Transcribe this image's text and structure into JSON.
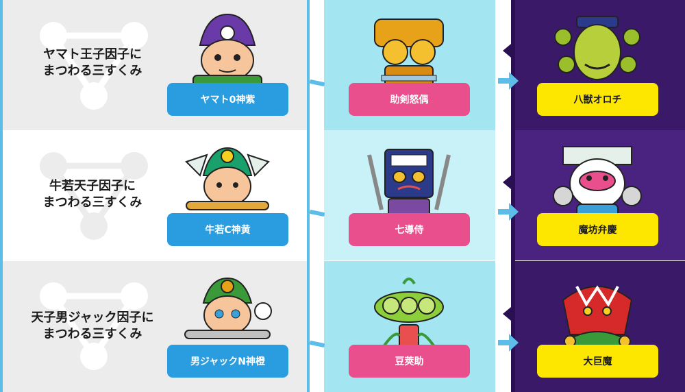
{
  "rows": [
    {
      "title": "ヤマト王子因子に\nまつわる三すくみ",
      "hero": "ヤマト0神紫",
      "mid": "助剣怒偶",
      "boss": "八獣オロチ",
      "hero_icon": "hero-prince-icon",
      "mid_icon": "golden-mask-icon",
      "boss_icon": "hydra-icon"
    },
    {
      "title": "牛若天子因子に\nまつわる三すくみ",
      "hero": "牛若C神黄",
      "mid": "七導侍",
      "boss": "魔坊弁慶",
      "hero_icon": "hero-angel-icon",
      "mid_icon": "slot-robot-icon",
      "boss_icon": "monk-icon"
    },
    {
      "title": "天子男ジャック因子に\nまつわる三すくみ",
      "hero": "男ジャックN神橙",
      "mid": "豆莢助",
      "boss": "大巨魔",
      "hero_icon": "hero-jack-icon",
      "mid_icon": "pea-pod-icon",
      "boss_icon": "giant-demon-icon"
    }
  ],
  "colors": {
    "left_bg": "#ececec",
    "mid_bg": "#a4e5f2",
    "right_bg": "#3a1a68",
    "plate_blue": "#2a9de0",
    "plate_pink": "#e94f8c",
    "plate_yellow": "#fde700",
    "accent": "#5bbde8"
  }
}
